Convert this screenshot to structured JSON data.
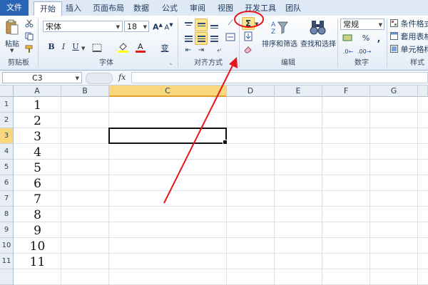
{
  "tabs": [
    "文件",
    "开始",
    "插入",
    "页面布局",
    "数据",
    "公式",
    "审阅",
    "视图",
    "开发工具",
    "团队"
  ],
  "clipboard": {
    "paste": "粘贴",
    "group": "剪贴板"
  },
  "font": {
    "name": "宋体",
    "size": "18",
    "group": "字体",
    "bold": "B",
    "italic": "I",
    "underline": "U",
    "grow": "A",
    "shrink": "A",
    "phonetic": "变"
  },
  "alignment": {
    "group": "对齐方式"
  },
  "editing": {
    "autosum": "Σ",
    "sort_filter": "排序和筛选",
    "find_select": "查找和选择",
    "group": "编辑"
  },
  "number": {
    "format": "常规",
    "group": "数字",
    "percent": "%",
    "comma": ","
  },
  "styles": {
    "conditional": "条件格式",
    "table": "套用表格",
    "cell": "单元格样",
    "group": "样式"
  },
  "formula_bar": {
    "name_box": "C3",
    "fx": "fx",
    "value": ""
  },
  "columns": [
    "A",
    "B",
    "C",
    "D",
    "E",
    "F",
    "G"
  ],
  "rows": [
    "1",
    "2",
    "3",
    "4",
    "5",
    "6",
    "7",
    "8",
    "9",
    "10",
    "11"
  ],
  "cells_a": [
    "1",
    "2",
    "3",
    "4",
    "5",
    "6",
    "7",
    "8",
    "9",
    "10",
    "11"
  ],
  "active_cell": "C3",
  "colors": {
    "annotation": "#e8141b",
    "highlight": "#fde58f",
    "selected_header": "#f9d77d",
    "file_tab": "#2a64b5"
  }
}
